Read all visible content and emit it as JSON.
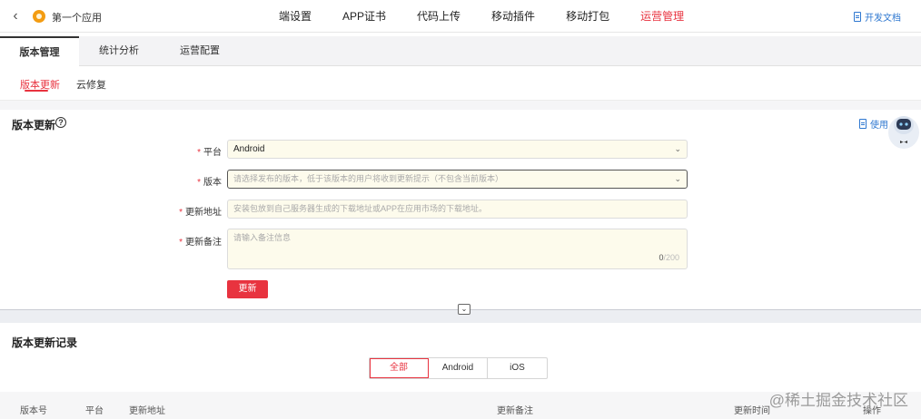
{
  "header": {
    "app_name": "第一个应用",
    "nav": [
      "端设置",
      "APP证书",
      "代码上传",
      "移动插件",
      "移动打包",
      "运营管理"
    ],
    "active_nav": "运营管理",
    "doc_link": "开发文档"
  },
  "tabs": [
    "版本管理",
    "统计分析",
    "运营配置"
  ],
  "subtabs": [
    "版本更新",
    "云修复"
  ],
  "update": {
    "title": "版本更新",
    "usage_link": "使用",
    "platform_label": "平台",
    "platform_value": "Android",
    "version_label": "版本",
    "version_placeholder": "请选择发布的版本，低于该版本的用户将收到更新提示（不包含当前版本）",
    "url_label": "更新地址",
    "url_placeholder": "安装包放到自己服务器生成的下载地址或APP在应用市场的下载地址。",
    "note_label": "更新备注",
    "note_placeholder": "请输入备注信息",
    "note_count": "0",
    "note_max": "/200",
    "submit_label": "更新"
  },
  "records": {
    "title": "版本更新记录",
    "filters": [
      "全部",
      "Android",
      "iOS"
    ],
    "columns": [
      "版本号",
      "平台",
      "更新地址",
      "更新备注",
      "更新时间",
      "操作"
    ]
  },
  "watermark": "@稀土掘金技术社区",
  "colors": {
    "accent": "#e8333f",
    "link": "#2e77d0"
  }
}
